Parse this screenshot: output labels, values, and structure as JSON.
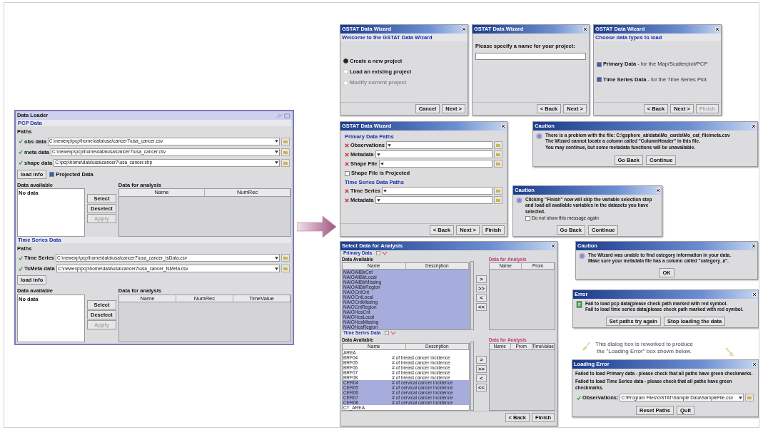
{
  "windows": [
    {
      "kind": "loader",
      "title": "Data Loader",
      "sections": [
        {
          "title": "PCP Data",
          "paths_label": "Paths",
          "paths": [
            {
              "label": "obs data",
              "value": "C:\\newexp\\pcp\\home\\data\\usa\\cancer7\\usa_cancer.csv",
              "valid": true
            },
            {
              "label": "meta data",
              "value": "C:\\newexp\\pcp\\home\\data\\usa\\cancer7\\usa_cancer.csv",
              "valid": true
            },
            {
              "label": "shape data",
              "value": "C:\\pcp\\home\\data\\usa\\cancer7\\usa_cancer.shp",
              "valid": true
            }
          ],
          "load_button": "load info",
          "projected": {
            "label": "Projected Data",
            "checked": true
          },
          "available_title": "Data available",
          "available_text": "No data",
          "buttons": [
            {
              "label": "Select",
              "disabled": false
            },
            {
              "label": "Deselect",
              "disabled": false
            },
            {
              "label": "Apply",
              "disabled": true
            }
          ],
          "analysis_title": "Data for analysis",
          "columns": [
            "Name",
            "NumRec"
          ]
        },
        {
          "title": "Time Series Data",
          "paths_label": "Paths",
          "paths": [
            {
              "label": "Time Series",
              "value": "C:\\newexp\\pcp\\home\\data\\usa\\cancer7\\usa_cancer_tsData.csv",
              "valid": true
            },
            {
              "label": "TsMeta data",
              "value": "C:\\newexp\\pcp\\home\\data\\usa\\cancer7\\usa_cancer_tsMeta.csv",
              "valid": true
            }
          ],
          "load_button": "load info",
          "available_title": "Data available",
          "available_text": "No data",
          "buttons": [
            {
              "label": "Select",
              "disabled": false
            },
            {
              "label": "Deselect",
              "disabled": false
            },
            {
              "label": "Apply",
              "disabled": true
            }
          ],
          "analysis_title": "Data for analysis",
          "columns": [
            "Name",
            "NumRec",
            "TimeValue"
          ]
        }
      ]
    },
    {
      "kind": "welcome",
      "title": "GSTAT Data Wizard",
      "subtitle": "Welcome to the GSTAT Data Wizard",
      "options": [
        {
          "label": "Create a new project",
          "selected": true,
          "disabled": false
        },
        {
          "label": "Load an existing project",
          "selected": false,
          "disabled": false
        },
        {
          "label": "Modify current project",
          "selected": false,
          "disabled": true
        }
      ],
      "buttons": [
        {
          "label": "Cancel",
          "disabled": false
        },
        {
          "label": "Next >",
          "disabled": false
        }
      ]
    },
    {
      "kind": "name",
      "title": "GSTAT Data Wizard",
      "prompt": "Please specify a name for your project:",
      "buttons": [
        {
          "label": "< Back",
          "disabled": false
        },
        {
          "label": "Next >",
          "disabled": false
        }
      ]
    },
    {
      "kind": "types",
      "title": "GSTAT Data Wizard",
      "subtitle": "Choose data types to load",
      "options": [
        {
          "label": "Primary Data",
          "detail": "- for the Map/Scatterplot/PCP",
          "checked": true
        },
        {
          "label": "Time Series Data",
          "detail": "- for the Time Series Plot",
          "checked": true
        }
      ],
      "buttons": [
        {
          "label": "< Back",
          "disabled": false
        },
        {
          "label": "Next >",
          "disabled": false
        },
        {
          "label": "Finish",
          "disabled": true
        }
      ]
    },
    {
      "kind": "paths",
      "title": "GSTAT Data Wizard",
      "groups": [
        {
          "title": "Primary Data Paths",
          "paths": [
            {
              "label": "Observations",
              "valid": false
            },
            {
              "label": "Metadata",
              "valid": false
            },
            {
              "label": "Shape File",
              "valid": false
            }
          ],
          "projected": {
            "label": "Shape File is Projected",
            "checked": false
          }
        },
        {
          "title": "Time Series Data Paths",
          "paths": [
            {
              "label": "Time Series",
              "valid": false
            },
            {
              "label": "Metadata",
              "valid": false
            }
          ]
        }
      ],
      "buttons": [
        {
          "label": "< Back",
          "disabled": false
        },
        {
          "label": "Next >",
          "disabled": false
        },
        {
          "label": "Finish",
          "disabled": false
        }
      ]
    },
    {
      "kind": "message",
      "title": "Caution",
      "lines": [
        "There is a problem with the file:  C:\\gsphere_ab\\data\\Mo_cards\\Mo_cat_file\\meta.csv",
        "The Wizard cannot locate a column called \"ColumnHeader\" in this file.",
        "You may continue, but some metadata functions will be unavailable."
      ],
      "buttons": [
        "Go Back",
        "Continue"
      ]
    },
    {
      "kind": "message",
      "title": "Caution",
      "lines": [
        "Clicking \"Finish\" now will skip the variable selection step and load all available variables in the datasets you have selected."
      ],
      "checkbox": {
        "label": "Do not show this message again",
        "checked": false
      },
      "buttons": [
        "Go Back",
        "Continue"
      ]
    },
    {
      "kind": "select",
      "title": "Select Data for Analysis",
      "panels": [
        {
          "title": "Primary Data",
          "available_title": "Data Available",
          "columns": [
            "Name",
            "Description"
          ],
          "rows": [
            {
              "name": "NAIOAllBirCnt",
              "selected": true
            },
            {
              "name": "NAIOAllBirLocal",
              "selected": true
            },
            {
              "name": "NAIOAllBirMissing",
              "selected": true
            },
            {
              "name": "NAIOAllBirRegion",
              "selected": true
            },
            {
              "name": "NAIOCntCnt",
              "selected": true
            },
            {
              "name": "NAIOCntLocal",
              "selected": true
            },
            {
              "name": "NAIOCntMissing",
              "selected": true
            },
            {
              "name": "NAIOCntRegion",
              "selected": true
            },
            {
              "name": "NAIOHosCnt",
              "selected": true
            },
            {
              "name": "NAIOHosLocal",
              "selected": true
            },
            {
              "name": "NAIOHosMissing",
              "selected": true
            },
            {
              "name": "NAIOHosRegion",
              "selected": true
            }
          ],
          "move_buttons": [
            ">",
            ">>",
            "<",
            "<<"
          ],
          "analysis_title": "Data for Analysis",
          "analysis_columns": [
            "Name",
            "Prom"
          ]
        },
        {
          "title": "Time Series Data",
          "available_title": "Data Available",
          "columns": [
            "Name",
            "Description"
          ],
          "rows": [
            {
              "name": "AREA",
              "selected": false
            },
            {
              "name": "BRF04",
              "description": "# of breast cancer incidence",
              "selected": false
            },
            {
              "name": "BRF05",
              "description": "# of breast cancer incidence",
              "selected": false
            },
            {
              "name": "BRF06",
              "description": "# of breast cancer incidence",
              "selected": false
            },
            {
              "name": "BRF07",
              "description": "# of breast cancer incidence",
              "selected": false
            },
            {
              "name": "BRF08",
              "description": "# of breast cancer incidence",
              "selected": false
            },
            {
              "name": "CER04",
              "description": "# of cervical cancer incidence",
              "selected": true
            },
            {
              "name": "CER05",
              "description": "# of cervical cancer incidence",
              "selected": true
            },
            {
              "name": "CER06",
              "description": "# of cervical cancer incidence",
              "selected": true
            },
            {
              "name": "CER07",
              "description": "# of cervical cancer incidence",
              "selected": true
            },
            {
              "name": "CER08",
              "description": "# of cervical cancer incidence",
              "selected": true
            },
            {
              "name": "CT_AREA",
              "selected": false
            }
          ],
          "move_buttons": [
            ">",
            ">>",
            "<",
            "<<"
          ],
          "analysis_title": "Data for Analysis",
          "analysis_columns": [
            "Name",
            "Prom",
            "TimeValue"
          ]
        }
      ],
      "buttons": [
        {
          "label": "< Back",
          "disabled": false
        },
        {
          "label": "Finish",
          "disabled": false
        }
      ]
    },
    {
      "kind": "message",
      "title": "Caution",
      "lines": [
        "The Wizard was unable to find category information in your data.",
        "Make sure your metadata file has a column called \"category_a\"."
      ],
      "buttons": [
        "OK"
      ]
    },
    {
      "kind": "message",
      "title": "Error",
      "lines": [
        "Fail to load pcp data(please check path marked with red symbol.",
        "Fail to load time series data(please check path marked with red symbol."
      ],
      "buttons": [
        "Set paths try again",
        "Stop loading the data"
      ]
    },
    {
      "kind": "loading",
      "title": "Loading Error",
      "lines": [
        "Failed to load Primary data - please check that all paths have green checkmarks.",
        "Failed to load Time Series data - please check that all paths have green checkmarks."
      ],
      "path": {
        "label": "Observations:",
        "value": "C:\\Program Files\\GSTAT\\Sample Data\\SampleFile.csv",
        "valid": true
      },
      "buttons": [
        "Reset Paths",
        "Quit"
      ]
    }
  ],
  "annotation": {
    "lines": [
      "This dialog box is reworked to produce",
      "the \"Loading Error\" box shown below."
    ]
  }
}
